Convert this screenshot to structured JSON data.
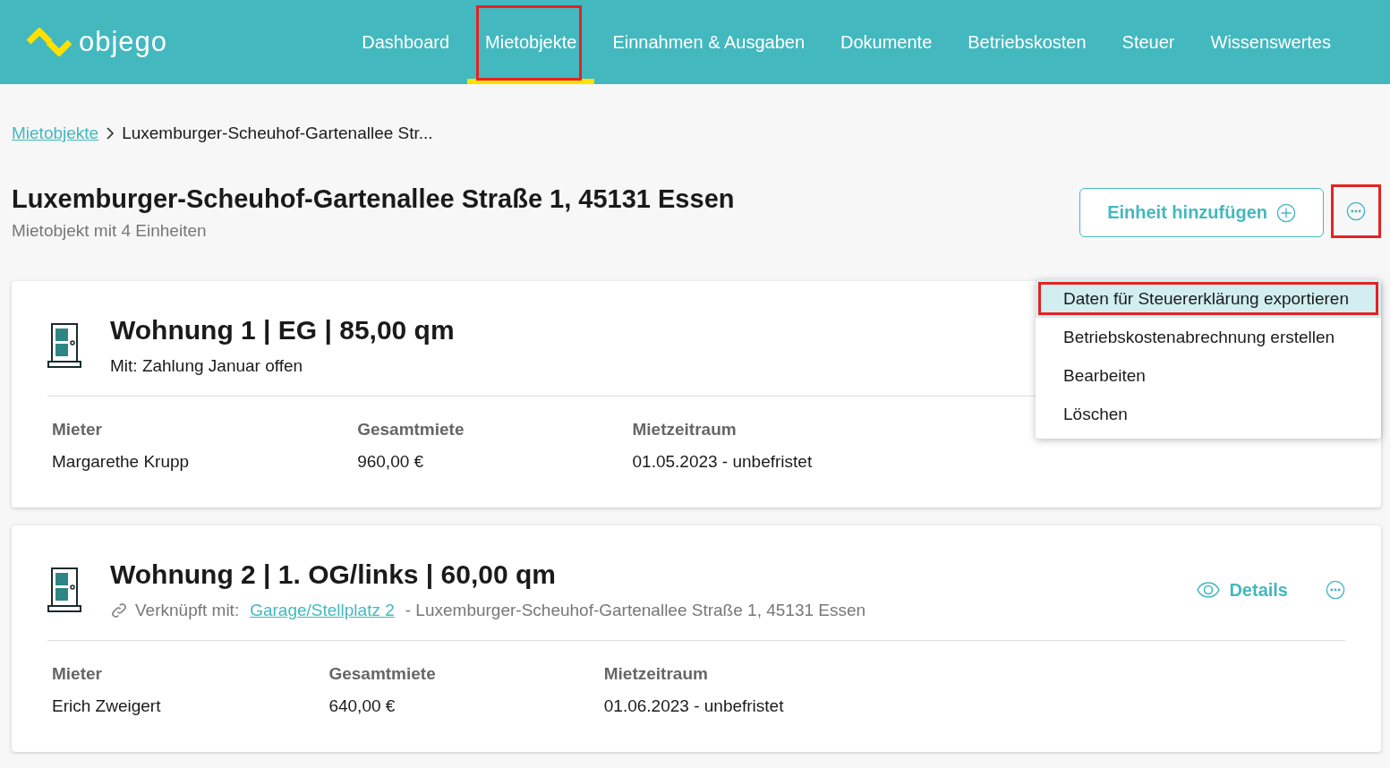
{
  "header": {
    "logo": "objego",
    "nav": [
      {
        "label": "Dashboard",
        "selected": false,
        "highlighted": false
      },
      {
        "label": "Mietobjekte",
        "selected": true,
        "highlighted": true
      },
      {
        "label": "Einnahmen & Ausgaben",
        "selected": false,
        "highlighted": false
      },
      {
        "label": "Dokumente",
        "selected": false,
        "highlighted": false
      },
      {
        "label": "Betriebskosten",
        "selected": false,
        "highlighted": false
      },
      {
        "label": "Steuer",
        "selected": false,
        "highlighted": false
      },
      {
        "label": "Wissenswertes",
        "selected": false,
        "highlighted": false
      }
    ]
  },
  "breadcrumb": {
    "link": "Mietobjekte",
    "current": "Luxemburger-Scheuhof-Gartenallee Str..."
  },
  "page": {
    "title": "Luxemburger-Scheuhof-Gartenallee Straße 1, 45131 Essen",
    "subtitle": "Mietobjekt mit 4 Einheiten",
    "add_button": "Einheit hinzufügen",
    "more_highlighted": true
  },
  "menu": [
    {
      "label": "Daten für Steuererklärung exportieren",
      "selected": true,
      "highlighted": true
    },
    {
      "label": "Betriebskostenabrechnung erstellen",
      "selected": false,
      "highlighted": false
    },
    {
      "label": "Bearbeiten",
      "selected": false,
      "highlighted": false
    },
    {
      "label": "Löschen",
      "selected": false,
      "highlighted": false
    }
  ],
  "units": [
    {
      "title": "Wohnung 1 | EG | 85,00 qm",
      "kind": "note",
      "note": "Mit: Zahlung Januar offen",
      "fields": [
        {
          "label": "Mieter",
          "value": "Margarethe Krupp"
        },
        {
          "label": "Gesamtmiete",
          "value": "960,00 €"
        },
        {
          "label": "Mietzeitraum",
          "value": "01.05.2023 - unbefristet"
        }
      ]
    },
    {
      "title": "Wohnung 2 | 1. OG/links | 60,00 qm",
      "kind": "linked",
      "linked_label": "Verknüpft mit:",
      "linked_link": "Garage/Stellplatz 2",
      "linked_rest": "- Luxemburger-Scheuhof-Gartenallee Straße 1, 45131 Essen",
      "details": "Details",
      "fields": [
        {
          "label": "Mieter",
          "value": "Erich Zweigert"
        },
        {
          "label": "Gesamtmiete",
          "value": "640,00 €"
        },
        {
          "label": "Mietzeitraum",
          "value": "01.06.2023 - unbefristet"
        }
      ]
    }
  ]
}
